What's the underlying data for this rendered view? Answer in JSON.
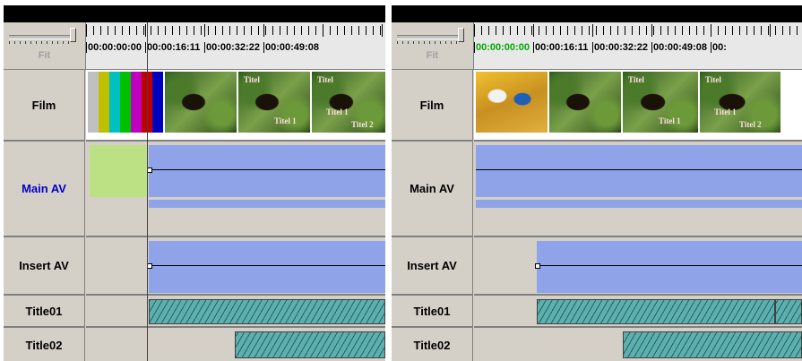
{
  "panels": [
    {
      "zoom_label": "Fit",
      "timecodes": [
        "00:00:00:00",
        "00:00:16:11",
        "00:00:32:22",
        "00:00:49:08"
      ],
      "first_timecode_color": "#000000",
      "tracks": [
        "Film",
        "Main AV",
        "Insert AV",
        "Title01",
        "Title02"
      ],
      "active_track": "Main AV",
      "film_captions": [
        "Titel",
        "Titel 1",
        "Titel",
        "Titel 1",
        "Titel 2"
      ]
    },
    {
      "zoom_label": "Fit",
      "timecodes": [
        "00:00:00:00",
        "00:00:16:11",
        "00:00:32:22",
        "00:00:49:08",
        "00:"
      ],
      "first_timecode_color": "#00aa00",
      "tracks": [
        "Film",
        "Main AV",
        "Insert AV",
        "Title01",
        "Title02"
      ],
      "active_track": "",
      "film_captions": [
        "Titel",
        "Titel 1",
        "Titel",
        "Titel 1",
        "Titel 2"
      ]
    }
  ],
  "colors": {
    "clip_blue": "#8ea3e8",
    "clip_green": "#bce084",
    "title_hatch": "#5cb0b0",
    "active_track_label": "#0000cc"
  }
}
